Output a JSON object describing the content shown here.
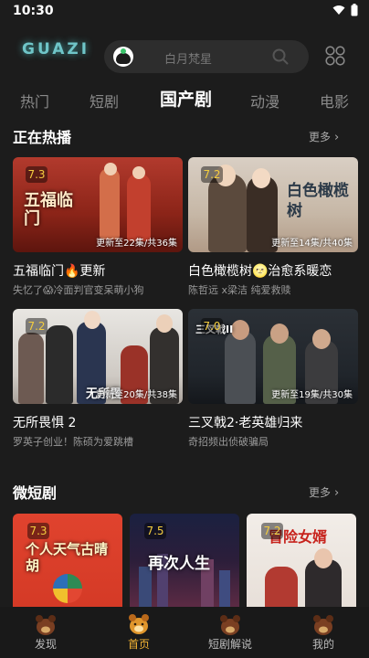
{
  "status_bar": {
    "time": "10:30"
  },
  "header": {
    "logo": "GUAZI",
    "search_placeholder": "白月梵星"
  },
  "tabs": [
    {
      "label": "热门",
      "active": false
    },
    {
      "label": "短剧",
      "active": false
    },
    {
      "label": "国产剧",
      "active": true
    },
    {
      "label": "动漫",
      "active": false
    },
    {
      "label": "电影",
      "active": false
    }
  ],
  "hot": {
    "title": "正在热播",
    "more": "更多",
    "items": [
      {
        "score": "7.3",
        "episodes": "更新至22集/共36集",
        "title": "五福临门🔥更新",
        "subtitle": "失忆了😱冷面判官变呆萌小狗",
        "poster_text": "五福临门"
      },
      {
        "score": "7.2",
        "episodes": "更新至14集/共40集",
        "title": "白色橄榄树🌝治愈系暖恋",
        "subtitle": "陈哲远 x梁洁 纯爱救赎",
        "poster_text": "白色橄榄树"
      },
      {
        "score": "7.2",
        "episodes": "更新至20集/共38集",
        "title": "无所畏惧 2",
        "subtitle": "罗英子创业！陈硕为爱跳槽",
        "poster_text": "无所畏"
      },
      {
        "score": "7.0",
        "episodes": "更新至19集/共30集",
        "title": "三叉戟2·老英雄归来",
        "subtitle": "奇招频出侦破骗局",
        "poster_text": "三叉戟II"
      }
    ]
  },
  "shorts": {
    "title": "微短剧",
    "more": "更多",
    "items": [
      {
        "score": "7.3",
        "poster_text": "个人天气古晴胡"
      },
      {
        "score": "7.5",
        "poster_text": "再次人生"
      },
      {
        "score": "7.2",
        "poster_text": "冒险女婿"
      }
    ]
  },
  "bottom_nav": [
    {
      "label": "发现",
      "icon": "discover-icon",
      "active": false
    },
    {
      "label": "首页",
      "icon": "home-icon",
      "active": true
    },
    {
      "label": "短剧解说",
      "icon": "short-drama-icon",
      "active": false
    },
    {
      "label": "我的",
      "icon": "profile-icon",
      "active": false
    }
  ],
  "colors": {
    "background": "#1c1c1c",
    "score": "#f3cc3f",
    "accent": "#f3b334"
  }
}
